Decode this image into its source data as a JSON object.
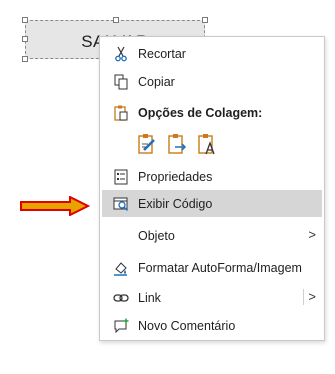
{
  "shape": {
    "label": "SALVAR"
  },
  "menu": {
    "items": {
      "cut": "Recortar",
      "copy": "Copiar",
      "paste_options": "Opções de Colagem:",
      "properties": "Propriedades",
      "view_code": "Exibir Código",
      "object": "Objeto",
      "format_shape": "Formatar AutoForma/Imagem",
      "link": "Link",
      "new_comment": "Novo Comentário"
    },
    "submenu_arrow": ">",
    "highlighted": "view_code"
  },
  "colors": {
    "accent_icon": "#1e6fbf",
    "paste_icon": "#c87a1c",
    "highlight_bg": "#d6d6d6",
    "pointer_arrow": "#e8a300",
    "pointer_arrow_edge": "#e00000"
  },
  "icons": [
    "scissors-icon",
    "copy-icon",
    "paste-icon",
    "paste-keep-format-icon",
    "paste-picture-icon",
    "paste-text-only-icon",
    "properties-icon",
    "view-code-icon",
    "format-shape-icon",
    "link-icon",
    "new-comment-icon",
    "chevron-right-icon",
    "red-pointer-arrow"
  ]
}
